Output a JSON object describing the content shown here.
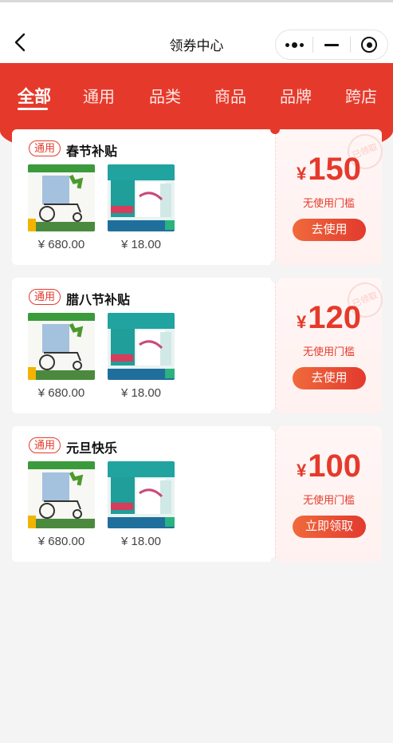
{
  "navbar": {
    "title": "领券中心",
    "back_icon": "chevron-left-icon",
    "capsule_icons": [
      "more-dots-icon",
      "minimize-icon",
      "target-icon"
    ]
  },
  "tabs": [
    {
      "label": "全部",
      "active": true
    },
    {
      "label": "通用",
      "active": false
    },
    {
      "label": "品类",
      "active": false
    },
    {
      "label": "商品",
      "active": false
    },
    {
      "label": "品牌",
      "active": false
    },
    {
      "label": "跨店",
      "active": false
    }
  ],
  "colors": {
    "accent": "#e53a2b",
    "button_gradient_start": "#f06a3c",
    "button_gradient_end": "#e23a2e"
  },
  "coupons": [
    {
      "tag": "通用",
      "name": "春节补贴",
      "products": [
        {
          "price": "¥ 680.00",
          "image": "wheelchair"
        },
        {
          "price": "¥ 18.00",
          "image": "nursing-pad-pack"
        }
      ],
      "currency": "¥",
      "amount": "150",
      "threshold": "无使用门槛",
      "button": "去使用",
      "stamp": "已领取"
    },
    {
      "tag": "通用",
      "name": "腊八节补贴",
      "products": [
        {
          "price": "¥ 680.00",
          "image": "wheelchair"
        },
        {
          "price": "¥ 18.00",
          "image": "nursing-pad-pack"
        }
      ],
      "currency": "¥",
      "amount": "120",
      "threshold": "无使用门槛",
      "button": "去使用",
      "stamp": "已领取"
    },
    {
      "tag": "通用",
      "name": "元旦快乐",
      "products": [
        {
          "price": "¥ 680.00",
          "image": "wheelchair"
        },
        {
          "price": "¥ 18.00",
          "image": "nursing-pad-pack"
        }
      ],
      "currency": "¥",
      "amount": "100",
      "threshold": "无使用门槛",
      "button": "立即领取",
      "stamp": ""
    }
  ]
}
